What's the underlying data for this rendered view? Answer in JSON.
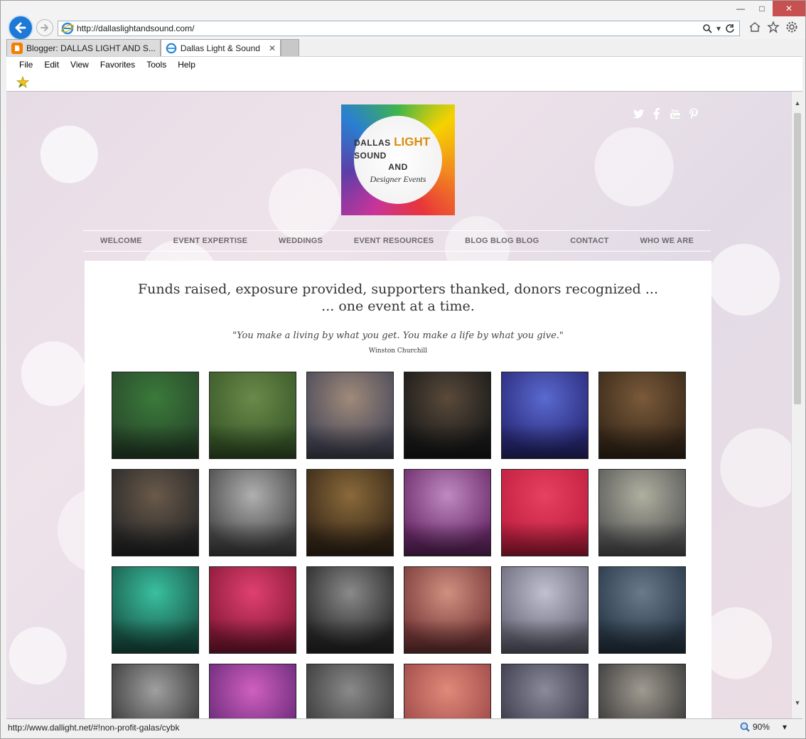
{
  "browser": {
    "url": "http://dallaslightandsound.com/",
    "tabs": [
      {
        "label": "Blogger: DALLAS LIGHT AND S..."
      },
      {
        "label": "Dallas Light & Sound"
      }
    ],
    "menu": [
      "File",
      "Edit",
      "View",
      "Favorites",
      "Tools",
      "Help"
    ],
    "status_url": "http://www.dallight.net/#!non-profit-galas/cybk",
    "zoom": "90%"
  },
  "site": {
    "logo": {
      "line1": "DALLAS",
      "line2": "LIGHT",
      "line3": "SOUND",
      "line4": "AND",
      "line5": "Designer Events"
    },
    "nav": [
      "WELCOME",
      "EVENT EXPERTISE",
      "WEDDINGS",
      "EVENT RESOURCES",
      "BLOG BLOG BLOG",
      "CONTACT",
      "WHO WE ARE"
    ],
    "headline_line1": "Funds raised, exposure provided, supporters thanked, donors recognized ...",
    "headline_line2": "... one event at a time.",
    "quote": "\"You make a living by what you get.  You make a life by what you give.\"",
    "author": "Winston Churchill",
    "social": [
      "twitter-icon",
      "facebook-icon",
      "youtube-icon",
      "pinterest-icon"
    ]
  },
  "colors": {
    "accent": "#1d78d6",
    "close": "#c75050"
  },
  "gallery_colors": [
    [
      "#2a4a2c",
      "#3a7a3a"
    ],
    [
      "#3a5a2a",
      "#6a8a4a"
    ],
    [
      "#4a4a5a",
      "#a08a7a"
    ],
    [
      "#1a1a1a",
      "#5a4a3a"
    ],
    [
      "#2a2a7a",
      "#5a6ad0"
    ],
    [
      "#3a2a1a",
      "#7a5a3a"
    ],
    [
      "#2a2a2a",
      "#6a5a4a"
    ],
    [
      "#4a4a4a",
      "#b0b0b0"
    ],
    [
      "#3a2a1a",
      "#8a6a3a"
    ],
    [
      "#6a2a6a",
      "#c08ac0"
    ],
    [
      "#c02040",
      "#e84060"
    ],
    [
      "#5a5a5a",
      "#b0b0a0"
    ],
    [
      "#1a5a4a",
      "#3ac0a0"
    ],
    [
      "#8a1a3a",
      "#e04070"
    ],
    [
      "#2a2a2a",
      "#8a8a8a"
    ],
    [
      "#7a3a3a",
      "#d09080"
    ],
    [
      "#6a6a7a",
      "#c0c0d0"
    ],
    [
      "#2a3a4a",
      "#6a7a8a"
    ],
    [
      "#3a3a3a",
      "#a0a0a0"
    ],
    [
      "#6a2a7a",
      "#d060c0"
    ],
    [
      "#3a3a3a",
      "#8a8a8a"
    ],
    [
      "#a04a4a",
      "#e08a7a"
    ],
    [
      "#3a3a4a",
      "#8a8a9a"
    ],
    [
      "#3a3a3a",
      "#a09a90"
    ]
  ]
}
